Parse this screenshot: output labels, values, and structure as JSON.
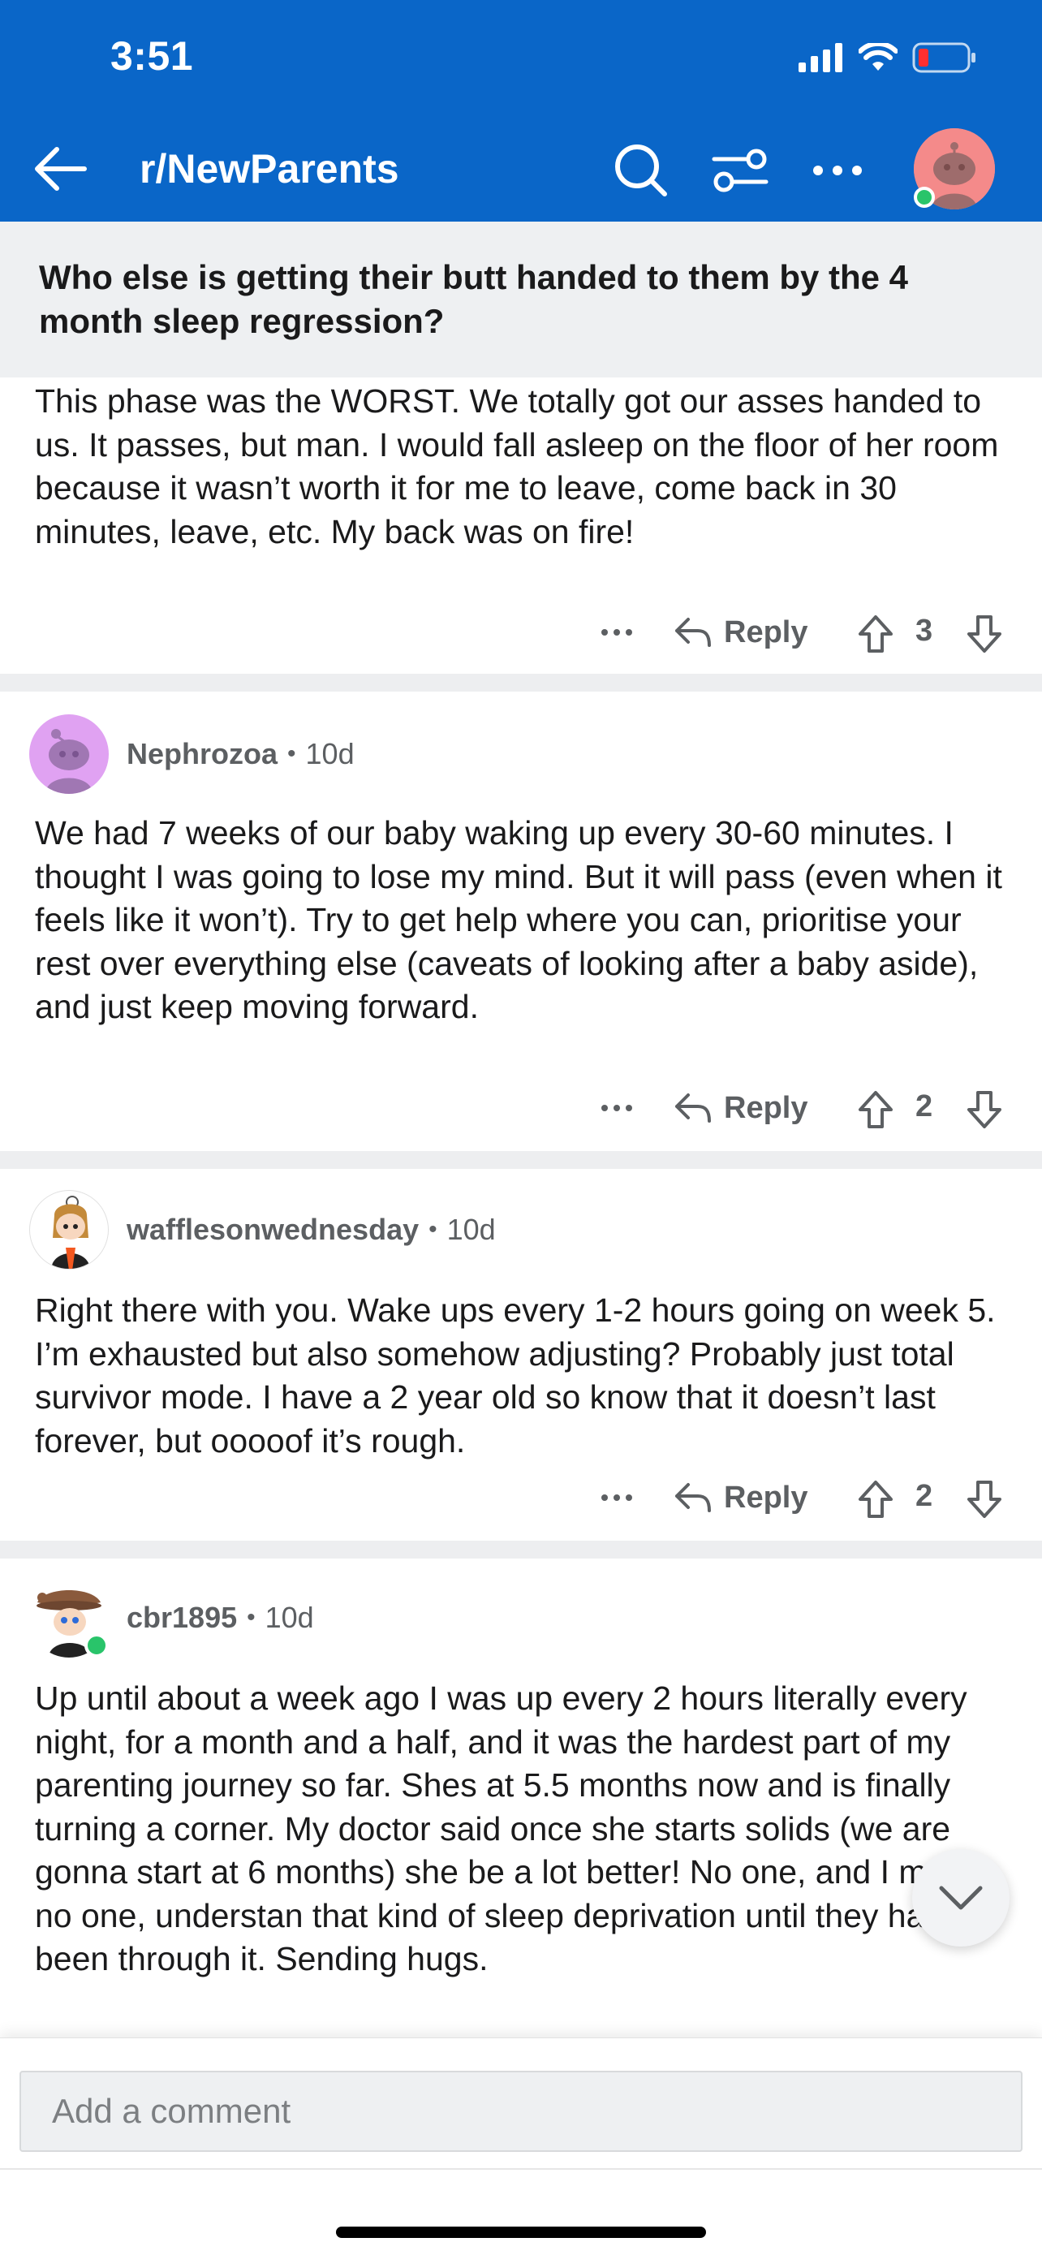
{
  "status_bar": {
    "time": "3:51"
  },
  "header": {
    "subreddit": "r/NewParents",
    "accent_color": "#0a66c8"
  },
  "post": {
    "title": "Who else is getting their butt handed to them by the 4 month sleep regression?"
  },
  "comments": [
    {
      "body": "This phase was the WORST. We totally got our asses handed to us. It passes, but man. I would fall asleep on the floor of her room because it wasn’t worth it for me to leave, come back in 30 minutes, leave, etc. My back was on fire!",
      "reply_label": "Reply",
      "score": "3"
    },
    {
      "username": "Nephrozoa",
      "age": "10d",
      "body": "We had 7 weeks of our baby waking up every 30-60 minutes. I thought I was going to lose my mind. But it will pass (even when it feels like it won’t). Try to get help where you can, prioritise your rest over everything else (caveats of looking after a baby aside), and just keep moving forward.",
      "reply_label": "Reply",
      "score": "2"
    },
    {
      "username": "wafflesonwednesday",
      "age": "10d",
      "body": "Right there with you. Wake ups every 1-2 hours going on week 5. I’m exhausted but also somehow adjusting? Probably just total survivor mode. I have a 2 year old so know that it doesn’t last forever, but ooooof it’s rough.",
      "reply_label": "Reply",
      "score": "2"
    },
    {
      "username": "cbr1895",
      "age": "10d",
      "body": "Up until about a week ago I was up every 2 hours literally every night, for a month and a half, and it was the hardest part of my parenting journey so far. Shes at 5.5 months now and is finally turning a corner. My doctor said once she starts solids (we are gonna start at 6 months) sh⁣e⁣ be a lot better! No one, and I mean no one, understan⁣ that kind of sleep deprivation until they have been through it. Sending hugs."
    }
  ],
  "composer": {
    "placeholder": "Add a comment"
  },
  "separator": "•"
}
